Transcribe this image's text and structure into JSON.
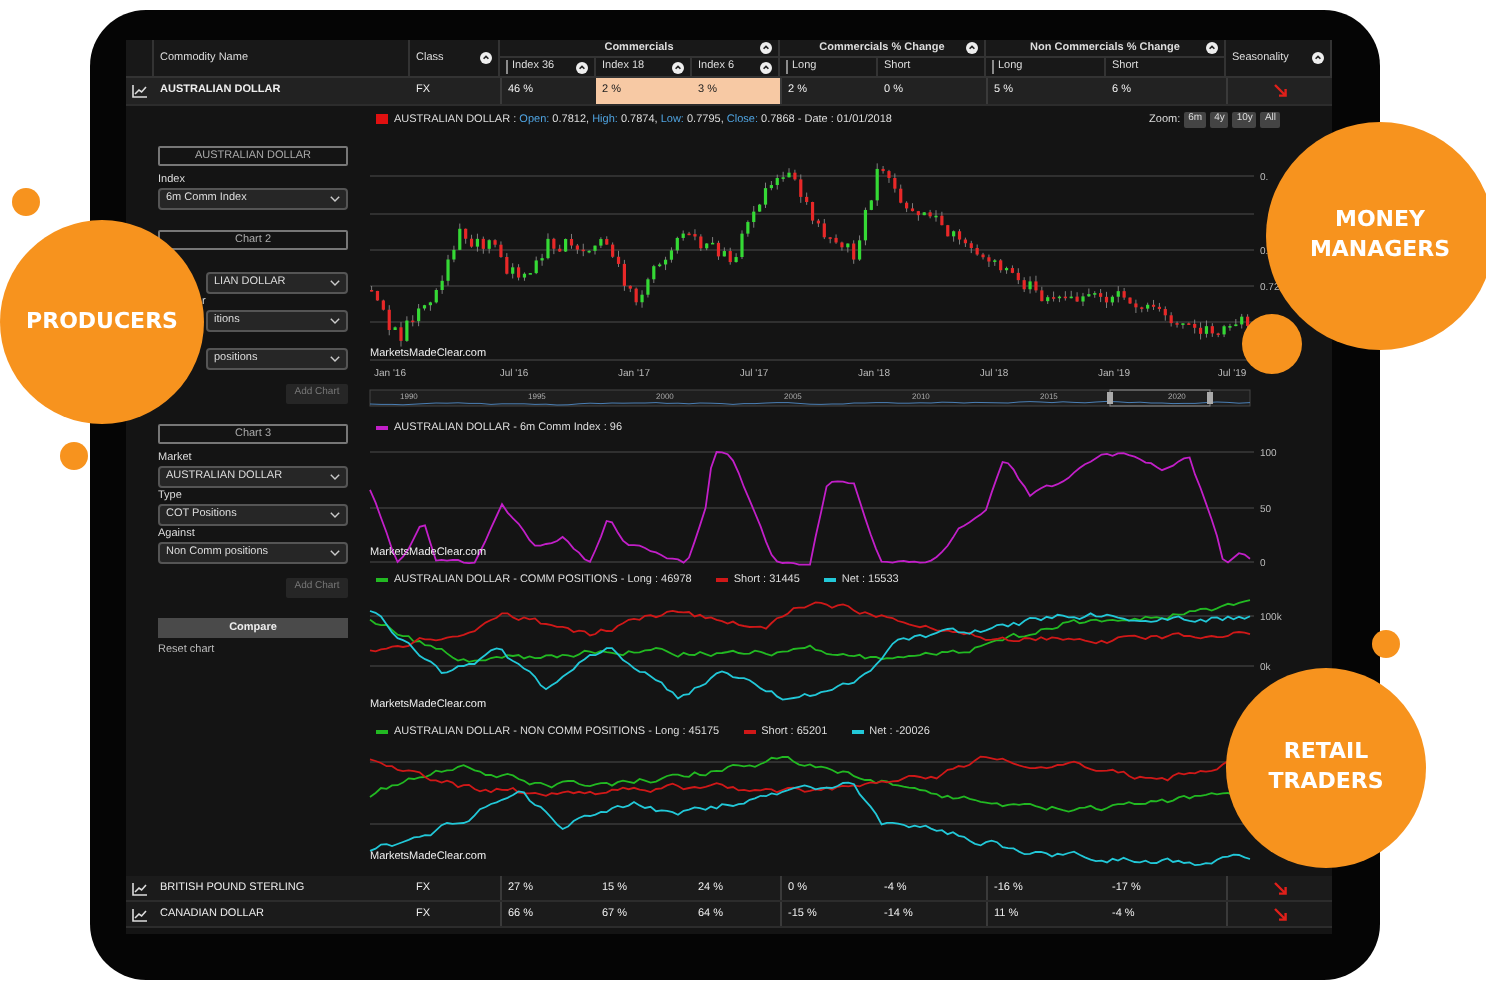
{
  "table": {
    "column_groups": [
      {
        "label": "Commercials",
        "info": true
      },
      {
        "label": "Commercials % Change",
        "info": true
      },
      {
        "label": "Non Commercials % Change",
        "info": true
      }
    ],
    "columns": [
      {
        "label": "Commodity Name",
        "info": false,
        "in_group": false,
        "group_start": false
      },
      {
        "label": "Class",
        "info": true,
        "in_group": false,
        "group_start": false
      },
      {
        "label": "Index 36",
        "info": true,
        "in_group": true,
        "group_start": true
      },
      {
        "label": "Index 18",
        "info": true,
        "in_group": true,
        "group_start": false
      },
      {
        "label": "Index 6",
        "info": true,
        "in_group": true,
        "group_start": false
      },
      {
        "label": "Long",
        "info": false,
        "in_group": true,
        "group_start": true
      },
      {
        "label": "Short",
        "info": false,
        "in_group": true,
        "group_start": false
      },
      {
        "label": "Long",
        "info": false,
        "in_group": true,
        "group_start": true
      },
      {
        "label": "Short",
        "info": false,
        "in_group": true,
        "group_start": false
      },
      {
        "label": "Seasonality",
        "info": true,
        "in_group": false,
        "group_start": false
      }
    ],
    "rows": [
      {
        "expanded": true,
        "seasonality_falling": true,
        "cells": [
          {
            "text": "AUSTRALIAN DOLLAR",
            "highlighted": false
          },
          {
            "text": "FX",
            "highlighted": false
          },
          {
            "text": "46 %",
            "highlighted": false
          },
          {
            "text": "2 %",
            "highlighted": true
          },
          {
            "text": "3 %",
            "highlighted": true
          },
          {
            "text": "2 %",
            "highlighted": false
          },
          {
            "text": "0 %",
            "highlighted": false
          },
          {
            "text": "5 %",
            "highlighted": false
          },
          {
            "text": "6 %",
            "highlighted": false
          }
        ]
      },
      {
        "expanded": false,
        "seasonality_falling": true,
        "cells": [
          {
            "text": "BRITISH POUND STERLING",
            "highlighted": false
          },
          {
            "text": "FX",
            "highlighted": false
          },
          {
            "text": "27 %",
            "highlighted": false
          },
          {
            "text": "15 %",
            "highlighted": false
          },
          {
            "text": "24 %",
            "highlighted": false
          },
          {
            "text": "0 %",
            "highlighted": false
          },
          {
            "text": "-4 %",
            "highlighted": false
          },
          {
            "text": "-16 %",
            "highlighted": false
          },
          {
            "text": "-17 %",
            "highlighted": false
          }
        ]
      },
      {
        "expanded": false,
        "seasonality_falling": true,
        "cells": [
          {
            "text": "CANADIAN DOLLAR",
            "highlighted": false
          },
          {
            "text": "FX",
            "highlighted": false
          },
          {
            "text": "66 %",
            "highlighted": false
          },
          {
            "text": "67 %",
            "highlighted": false
          },
          {
            "text": "64 %",
            "highlighted": false
          },
          {
            "text": "-15 %",
            "highlighted": false
          },
          {
            "text": "-14 %",
            "highlighted": false
          },
          {
            "text": "11 %",
            "highlighted": false
          },
          {
            "text": "-4 %",
            "highlighted": false
          }
        ]
      }
    ]
  },
  "sidebar": {
    "sections": [
      {
        "title": "AUSTRALIAN DOLLAR",
        "fields": [
          {
            "label": "Index",
            "value": "6m Comm Index"
          }
        ]
      },
      {
        "title": "Chart 2",
        "fields": [
          {
            "value": "LIAN DOLLAR"
          },
          {
            "label": "r",
            "value": "itions"
          },
          {
            "value": "positions"
          }
        ],
        "action": "Add Chart"
      },
      {
        "title": "Chart 3",
        "fields": [
          {
            "label": "Market",
            "value": "AUSTRALIAN DOLLAR"
          },
          {
            "label": "Type",
            "value": "COT Positions"
          },
          {
            "label": "Against",
            "value": "Non Comm positions"
          }
        ],
        "action": "Add Chart"
      }
    ],
    "compare": "Compare",
    "reset": "Reset chart"
  },
  "charts": [
    {
      "kind": "price",
      "name": "AUSTRALIAN DOLLAR :",
      "fields": [
        {
          "key": "Open:",
          "value": "0.7812,"
        },
        {
          "key": "High:",
          "value": "0.7874,"
        },
        {
          "key": "Low:",
          "value": "0.7795,"
        },
        {
          "key": "Close:",
          "value": "0.7868"
        }
      ],
      "date": "- Date : 01/01/2018",
      "zoom": {
        "label": "Zoom:",
        "options": [
          {
            "label": "6m",
            "selected": false
          },
          {
            "label": "4y",
            "selected": false
          },
          {
            "label": "10y",
            "selected": false
          },
          {
            "label": "All",
            "selected": false
          }
        ]
      },
      "x_labels": [
        "Jan '16",
        "Jul '16",
        "Jan '17",
        "Jul '17",
        "Jan '18",
        "Jul '18",
        "Jan '19",
        "Jul '19"
      ],
      "axis_labels": [
        "0.",
        "0.",
        "0.72"
      ],
      "navigator_labels": [
        "1990",
        "1995",
        "2000",
        "2005",
        "2010",
        "2015",
        "2020"
      ],
      "source": "MarketsMadeClear.com"
    },
    {
      "kind": "index",
      "series": [
        {
          "label": "AUSTRALIAN DOLLAR - 6m Comm Index : 96",
          "color": "#c21fc8"
        }
      ],
      "axis_labels": [
        "100",
        "50",
        "0"
      ],
      "source": "MarketsMadeClear.com"
    },
    {
      "kind": "positions",
      "series": [
        {
          "label": "AUSTRALIAN DOLLAR - COMM POSITIONS - Long : 46978",
          "color": "#22b922"
        },
        {
          "label": "Short : 31445",
          "color": "#d01818"
        },
        {
          "label": "Net : 15533",
          "color": "#22c8d8"
        }
      ],
      "axis_labels": [
        "100k",
        "0k"
      ],
      "source": "MarketsMadeClear.com"
    },
    {
      "kind": "positions",
      "series": [
        {
          "label": "AUSTRALIAN DOLLAR - NON COMM POSITIONS - Long : 45175",
          "color": "#22b922"
        },
        {
          "label": "Short : 65201",
          "color": "#d01818"
        },
        {
          "label": "Net : -20026",
          "color": "#22c8d8"
        }
      ],
      "source": "MarketsMadeClear.com"
    }
  ],
  "callouts": [
    {
      "label": "PRODUCERS"
    },
    {
      "label": "MONEY MANAGERS"
    },
    {
      "label": "RETAIL TRADERS"
    }
  ]
}
